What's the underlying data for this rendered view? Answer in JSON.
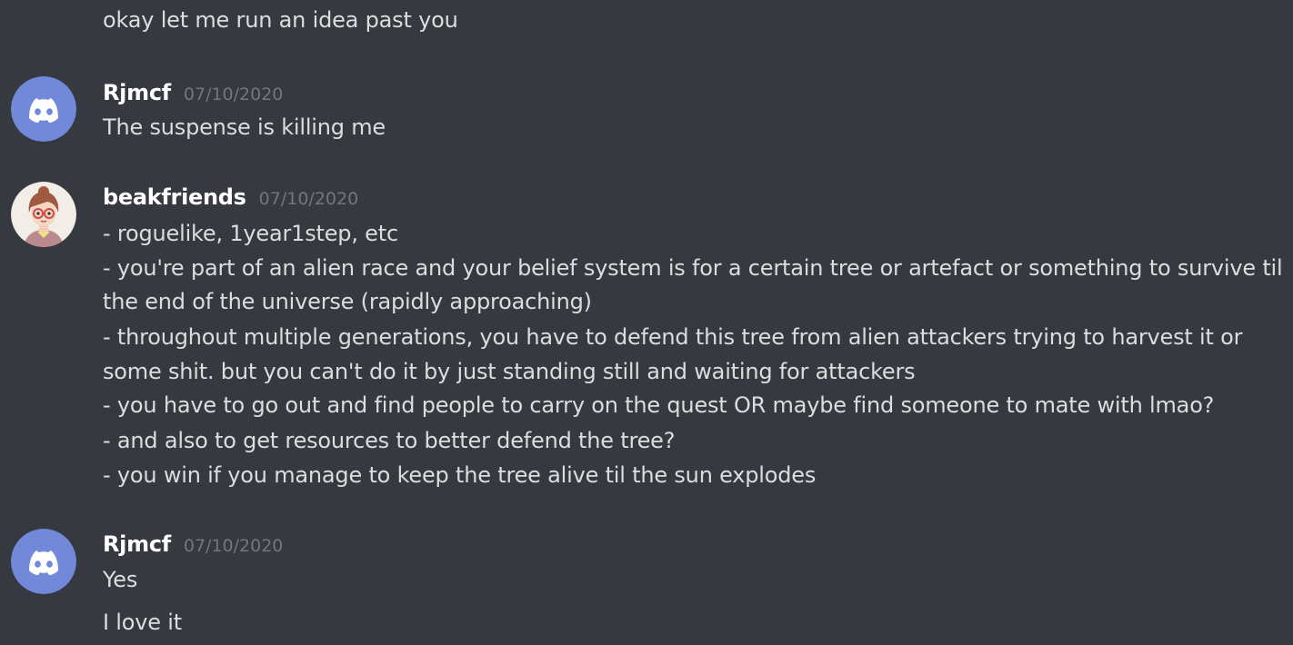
{
  "messages": {
    "continuation": {
      "text": "okay let me run an idea past you"
    },
    "m1": {
      "author": "Rjmcf",
      "timestamp": "07/10/2020",
      "avatar_icon": "discord-logo-icon",
      "lines": [
        "The suspense is killing me"
      ]
    },
    "m2": {
      "author": "beakfriends",
      "timestamp": "07/10/2020",
      "avatar_icon": "user-portrait-icon",
      "lines": [
        "- roguelike, 1year1step, etc",
        "- you're part of an alien race and your belief system is for a certain tree or artefact or something to survive til",
        "the end of the universe (rapidly approaching)",
        "- throughout multiple generations, you have to defend this tree from alien attackers trying to harvest it or",
        "some shit. but you can't do it by just standing still and waiting for attackers",
        "- you have to go out and find people to carry on the quest OR maybe find someone to mate with lmao?",
        "- and also to get resources to better defend the tree?",
        "- you win if you manage to keep the tree alive til the sun explodes"
      ]
    },
    "m3": {
      "author": "Rjmcf",
      "timestamp": "07/10/2020",
      "avatar_icon": "discord-logo-icon",
      "lines": [
        "Yes",
        "I love it"
      ]
    }
  },
  "colors": {
    "background": "#36393f",
    "text": "#dcddde",
    "author": "#ffffff",
    "timestamp": "#72767d",
    "discord_blurple": "#7289da"
  }
}
